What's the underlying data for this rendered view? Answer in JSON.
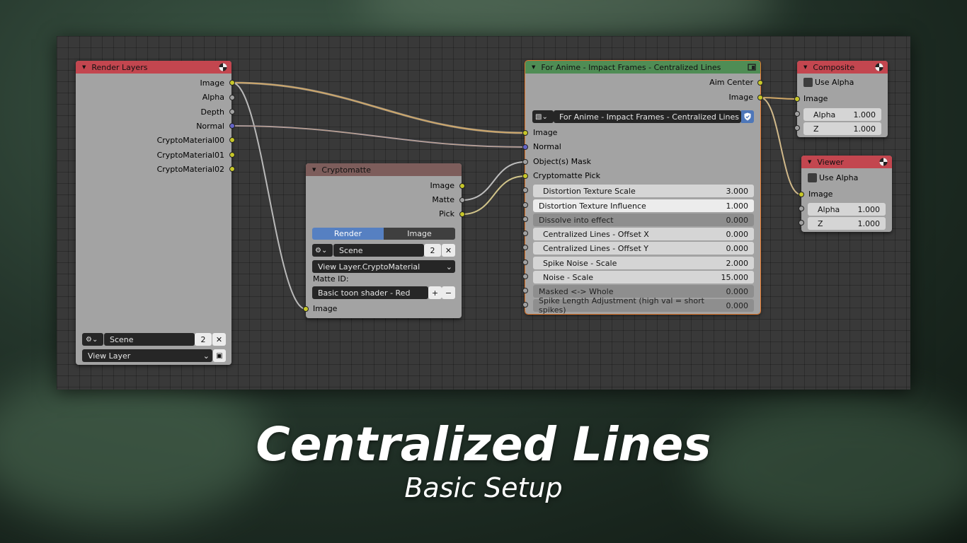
{
  "render_layers": {
    "title": "Render Layers",
    "outputs": [
      "Image",
      "Alpha",
      "Depth",
      "Normal",
      "CryptoMaterial00",
      "CryptoMaterial01",
      "CryptoMaterial02"
    ],
    "scene": "Scene",
    "scene_users": "2",
    "view_layer": "View Layer"
  },
  "cryptomatte": {
    "title": "Cryptomatte",
    "outputs": [
      "Image",
      "Matte",
      "Pick"
    ],
    "tab_render": "Render",
    "tab_image": "Image",
    "scene": "Scene",
    "scene_users": "2",
    "layer": "View Layer.CryptoMaterial",
    "matte_id_label": "Matte ID:",
    "matte_id_value": "Basic toon shader - Red",
    "input_image": "Image"
  },
  "group": {
    "title": "For Anime - Impact Frames - Centralized Lines",
    "outputs": [
      "Aim Center",
      "Image"
    ],
    "datablock": "For Anime - Impact Frames - Centralized Lines",
    "inputs": [
      "Image",
      "Normal",
      "Object(s) Mask",
      "Cryptomatte Pick"
    ],
    "params": [
      {
        "label": "Distortion Texture Scale",
        "value": "3.000"
      },
      {
        "label": "Distortion Texture Influence",
        "value": "1.000"
      },
      {
        "label": "Dissolve into effect",
        "value": "0.000"
      },
      {
        "label": "Centralized Lines - Offset X",
        "value": "0.000"
      },
      {
        "label": "Centralized Lines - Offset Y",
        "value": "0.000"
      },
      {
        "label": "Spike Noise - Scale",
        "value": "2.000"
      },
      {
        "label": "Noise - Scale",
        "value": "15.000"
      },
      {
        "label": "Masked <-> Whole",
        "value": "0.000"
      },
      {
        "label": "Spike Length Adjustment (high val = short spikes)",
        "value": "0.000"
      }
    ]
  },
  "composite": {
    "title": "Composite",
    "use_alpha": "Use Alpha",
    "image": "Image",
    "alpha_label": "Alpha",
    "alpha_value": "1.000",
    "z_label": "Z",
    "z_value": "1.000"
  },
  "viewer": {
    "title": "Viewer",
    "use_alpha": "Use Alpha",
    "image": "Image",
    "alpha_label": "Alpha",
    "alpha_value": "1.000",
    "z_label": "Z",
    "z_value": "1.000"
  },
  "caption": {
    "title": "Centralized Lines",
    "subtitle": "Basic Setup"
  },
  "colors": {
    "output_header": "#c3464f",
    "group_header": "#4f8d55",
    "matte_header": "#7d5d5b",
    "link_color": "#d1a867",
    "socket_color": "#c7c729",
    "vector_socket": "#6363c7",
    "tab_active": "#5680c2"
  }
}
